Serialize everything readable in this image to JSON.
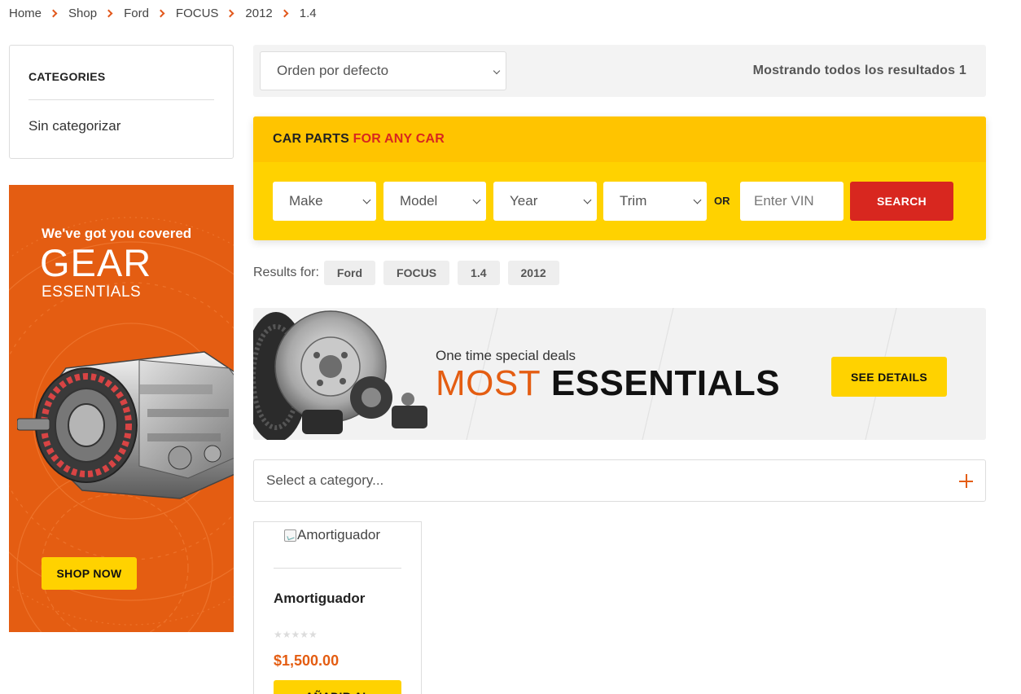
{
  "breadcrumb": [
    "Home",
    "Shop",
    "Ford",
    "FOCUS",
    "2012",
    "1.4"
  ],
  "sidebar": {
    "categories_title": "CATEGORIES",
    "category_item": "Sin categorizar"
  },
  "gear_banner": {
    "tagline": "We've got you covered",
    "title": "GEAR",
    "subtitle": "ESSENTIALS",
    "cta": "SHOP NOW"
  },
  "sort_bar": {
    "sort_value": "Orden por defecto",
    "results_text": "Mostrando todos los resultados 1"
  },
  "finder": {
    "title_prefix": "CAR PARTS",
    "title_accent": "FOR ANY CAR",
    "make": "Make",
    "model": "Model",
    "year": "Year",
    "trim": "Trim",
    "or": "OR",
    "vin_placeholder": "Enter VIN",
    "search": "SEARCH"
  },
  "results_for": {
    "label": "Results for:",
    "chips": [
      "Ford",
      "FOCUS",
      "1.4",
      "2012"
    ]
  },
  "essentials_banner": {
    "tagline": "One time special deals",
    "title_light": "MOST",
    "title_bold": "ESSENTIALS",
    "cta": "SEE DETAILS"
  },
  "category_select": {
    "placeholder": "Select a category..."
  },
  "product": {
    "image_alt": "Amortiguador",
    "name": "Amortiguador",
    "stars": "★★★★★",
    "price": "$1,500.00",
    "button": "AÑADIR AL"
  },
  "colors": {
    "accent_orange": "#e45d12",
    "yellow": "#ffd200",
    "red": "#d8271f"
  }
}
